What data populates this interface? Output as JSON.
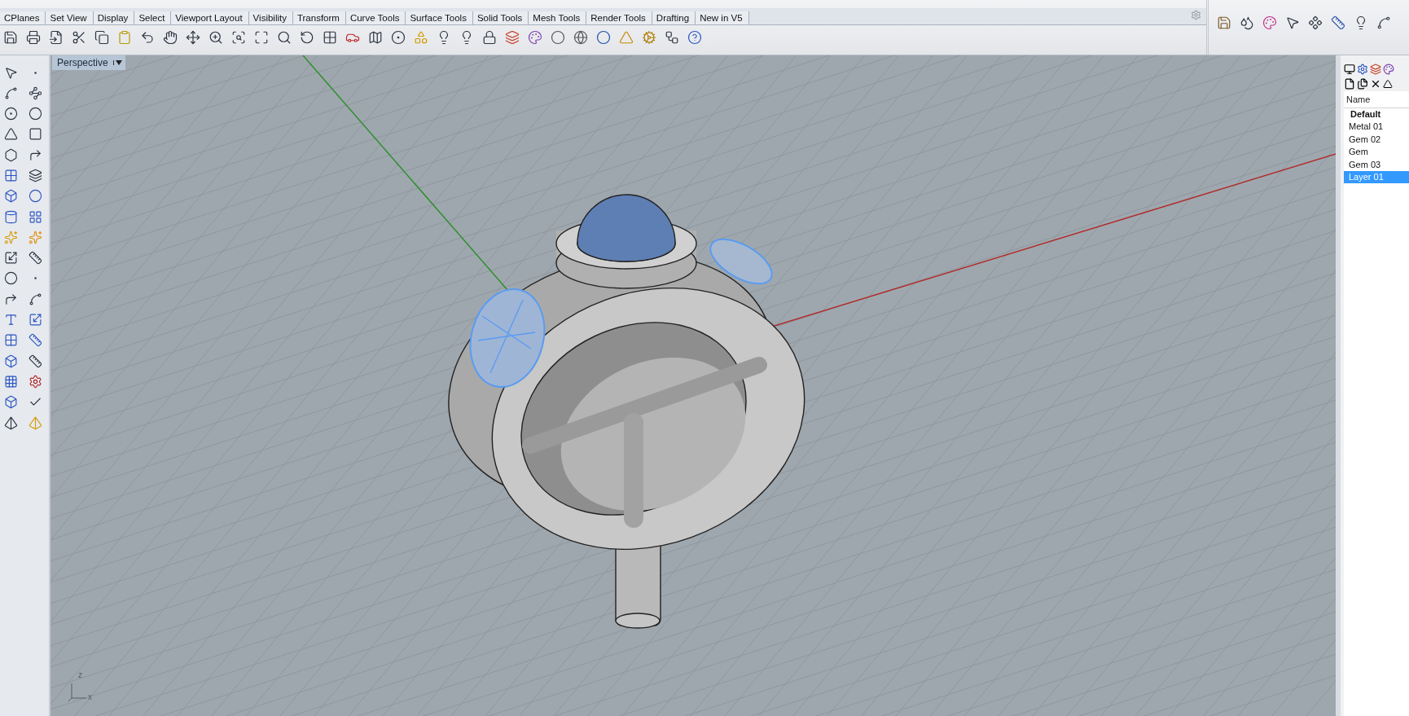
{
  "toolbar_tabs": [
    {
      "label": "CPlanes"
    },
    {
      "label": "Set View"
    },
    {
      "label": "Display"
    },
    {
      "label": "Select"
    },
    {
      "label": "Viewport Layout"
    },
    {
      "label": "Visibility"
    },
    {
      "label": "Transform"
    },
    {
      "label": "Curve Tools"
    },
    {
      "label": "Surface Tools"
    },
    {
      "label": "Solid Tools"
    },
    {
      "label": "Mesh Tools"
    },
    {
      "label": "Render Tools"
    },
    {
      "label": "Drafting"
    },
    {
      "label": "New in V5"
    }
  ],
  "viewport": {
    "title": "Perspective",
    "axis_labels": [
      "z",
      "x"
    ]
  },
  "layers_panel": {
    "column_header": "Name",
    "layers": [
      {
        "name": "Default",
        "current": true,
        "selected": false
      },
      {
        "name": "Metal 01",
        "current": false,
        "selected": false
      },
      {
        "name": "Gem 02",
        "current": false,
        "selected": false
      },
      {
        "name": "Gem",
        "current": false,
        "selected": false
      },
      {
        "name": "Gem 03",
        "current": false,
        "selected": false
      },
      {
        "name": "Layer 01",
        "current": false,
        "selected": true
      }
    ]
  }
}
